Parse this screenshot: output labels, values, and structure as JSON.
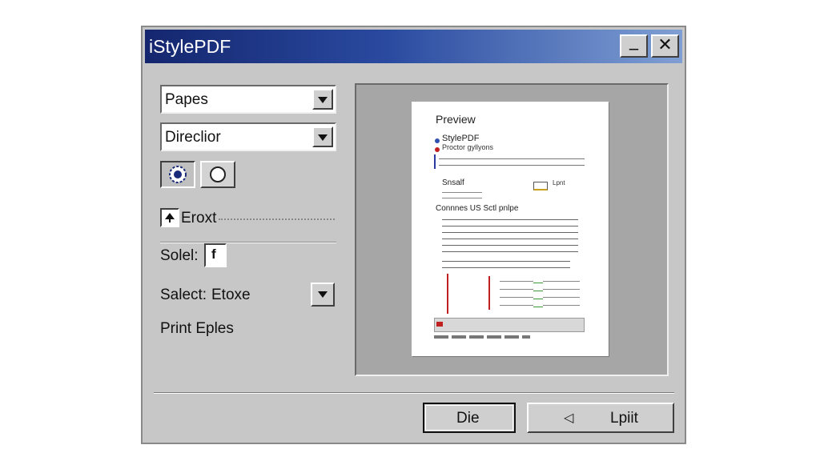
{
  "window": {
    "title": "iStylePDF",
    "minimize_label": "_",
    "close_label": "✕"
  },
  "left_panel": {
    "papes_select": "Papes",
    "direction_select": "Direclior",
    "text_checkbox_label": "Eroxt",
    "solid_label": "Solel:",
    "solid_value": "f",
    "select_label": "Salect:",
    "select_value": "Etoxe",
    "print_label": "Print Eples"
  },
  "preview": {
    "heading": "Preview",
    "line1": "StylePDF",
    "line2": "Proctor gyllyons",
    "list_item1": "Snsalf",
    "legend_small": "Lpnt",
    "section_heading": "Connnes US Sctl pnlpe"
  },
  "buttons": {
    "die": "Die",
    "left_arrow": "◁",
    "print": "Lpiit"
  },
  "colors": {
    "title_start": "#14266e",
    "title_end": "#7f9fd4",
    "panel": "#c7c7c7"
  }
}
